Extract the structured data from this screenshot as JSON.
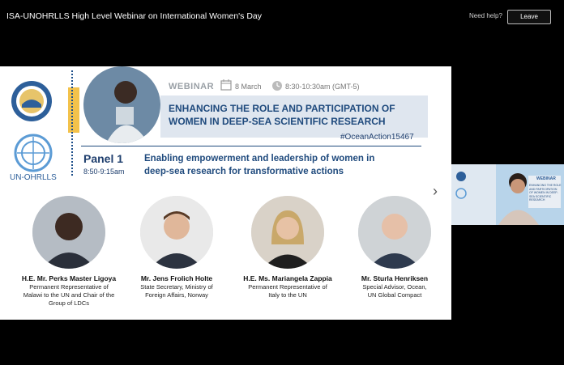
{
  "window": {
    "title": "ISA-UNOHRLLS High Level Webinar on International Women's Day",
    "help_link": "Need help?",
    "leave_button": "Leave"
  },
  "slide": {
    "logo_isa_text": "INTERNATIONAL SEABED AUTHORITY",
    "logo_un_label": "UN-OHRLLS",
    "webinar_label": "WEBINAR",
    "date": "8 March",
    "time": "8:30-10:30am (GMT-5)",
    "headline_line1": "ENHANCING THE ROLE AND PARTICIPATION OF",
    "headline_line2": "WOMEN IN DEEP-SEA SCIENTIFIC RESEARCH",
    "hashtag": "#OceanAction15467",
    "panel_label": "Panel 1",
    "panel_time": "8:50-9:15am",
    "subtitle_line1": "Enabling empowerment and leadership of women in",
    "subtitle_line2": "deep-sea research for transformative actions",
    "speakers": [
      {
        "name": "H.E. Mr. Perks Master Ligoya",
        "role_lines": [
          "Permanent Representative of",
          "Malawi to the UN and Chair of the",
          "Group of LDCs"
        ]
      },
      {
        "name": "Mr. Jens Frolich Holte",
        "role_lines": [
          "State Secretary,  Ministry of",
          "Foreign Affairs, Norway"
        ]
      },
      {
        "name": "H.E. Ms. Mariangela Zappia",
        "role_lines": [
          "Permanent Representative of",
          "Italy to the UN"
        ]
      },
      {
        "name": "Mr. Sturla Henriksen",
        "role_lines": [
          "Special Advisor, Ocean,",
          "UN Global Compact"
        ]
      }
    ]
  },
  "video_thumbnail": {
    "badge": "WEBINAR",
    "slide_text": "ENHANCING THE ROLE AND PARTICIPATION OF WOMEN IN DEEP-SEA SCIENTIFIC RESEARCH"
  },
  "colors": {
    "accent_navy": "#1f4a7d",
    "accent_yellow": "#f3c24b",
    "banner_bg": "#dfe6ef"
  }
}
